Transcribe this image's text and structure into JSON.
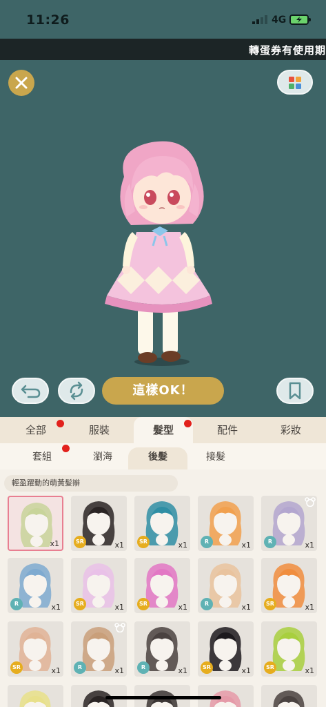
{
  "status": {
    "time": "11:26",
    "network": "4G"
  },
  "marquee": {
    "text": "轉蛋券有使用期"
  },
  "controls": {
    "ok_label": "這樣OK！"
  },
  "tabs_main": [
    {
      "label": "全部",
      "badge": true
    },
    {
      "label": "服裝",
      "badge": false
    },
    {
      "label": "髮型",
      "badge": true,
      "active": true
    },
    {
      "label": "配件",
      "badge": false
    },
    {
      "label": "彩妝",
      "badge": false
    }
  ],
  "tabs_sub": [
    {
      "label": "套組",
      "badge": true
    },
    {
      "label": "瀏海",
      "badge": false
    },
    {
      "label": "後髮",
      "badge": false,
      "active": true
    },
    {
      "label": "接髮",
      "badge": false
    }
  ],
  "item_description": "輕盈躍動的萌黃髮辮",
  "items": [
    {
      "rarity": "",
      "qty": "x1",
      "hair": "#c8d49a",
      "selected": true,
      "bear": false
    },
    {
      "rarity": "SR",
      "qty": "x1",
      "hair": "#2a2424",
      "selected": false,
      "bear": false
    },
    {
      "rarity": "SR",
      "qty": "x1",
      "hair": "#2f8ea4",
      "selected": false,
      "bear": false
    },
    {
      "rarity": "R",
      "qty": "x1",
      "hair": "#f1a04e",
      "selected": false,
      "bear": false
    },
    {
      "rarity": "R",
      "qty": "x1",
      "hair": "#b3a6cf",
      "selected": false,
      "bear": true
    },
    {
      "rarity": "R",
      "qty": "x1",
      "hair": "#7eaad0",
      "selected": false,
      "bear": false
    },
    {
      "rarity": "SR",
      "qty": "x1",
      "hair": "#e9c1e8",
      "selected": false,
      "bear": false
    },
    {
      "rarity": "SR",
      "qty": "x1",
      "hair": "#e277c4",
      "selected": false,
      "bear": false
    },
    {
      "rarity": "R",
      "qty": "x1",
      "hair": "#e9c39e",
      "selected": false,
      "bear": false
    },
    {
      "rarity": "SR",
      "qty": "x1",
      "hair": "#f08d3e",
      "selected": false,
      "bear": false
    },
    {
      "rarity": "SR",
      "qty": "x1",
      "hair": "#e0b396",
      "selected": false,
      "bear": false
    },
    {
      "rarity": "R",
      "qty": "x1",
      "hair": "#c99f7a",
      "selected": false,
      "bear": true
    },
    {
      "rarity": "R",
      "qty": "x1",
      "hair": "#4a4240",
      "selected": false,
      "bear": false
    },
    {
      "rarity": "SR",
      "qty": "x1",
      "hair": "#1d1a1e",
      "selected": false,
      "bear": false
    },
    {
      "rarity": "SR",
      "qty": "x1",
      "hair": "#a8cf3e",
      "selected": false,
      "bear": false
    },
    {
      "rarity": "",
      "qty": "",
      "hair": "#e8e08a",
      "selected": false,
      "bear": false
    },
    {
      "rarity": "",
      "qty": "",
      "hair": "#2a2424",
      "selected": false,
      "bear": false
    },
    {
      "rarity": "",
      "qty": "",
      "hair": "#3b3534",
      "selected": false,
      "bear": false
    },
    {
      "rarity": "",
      "qty": "",
      "hair": "#e59aa8",
      "selected": false,
      "bear": false
    },
    {
      "rarity": "",
      "qty": "",
      "hair": "#4a4240",
      "selected": false,
      "bear": false
    }
  ]
}
